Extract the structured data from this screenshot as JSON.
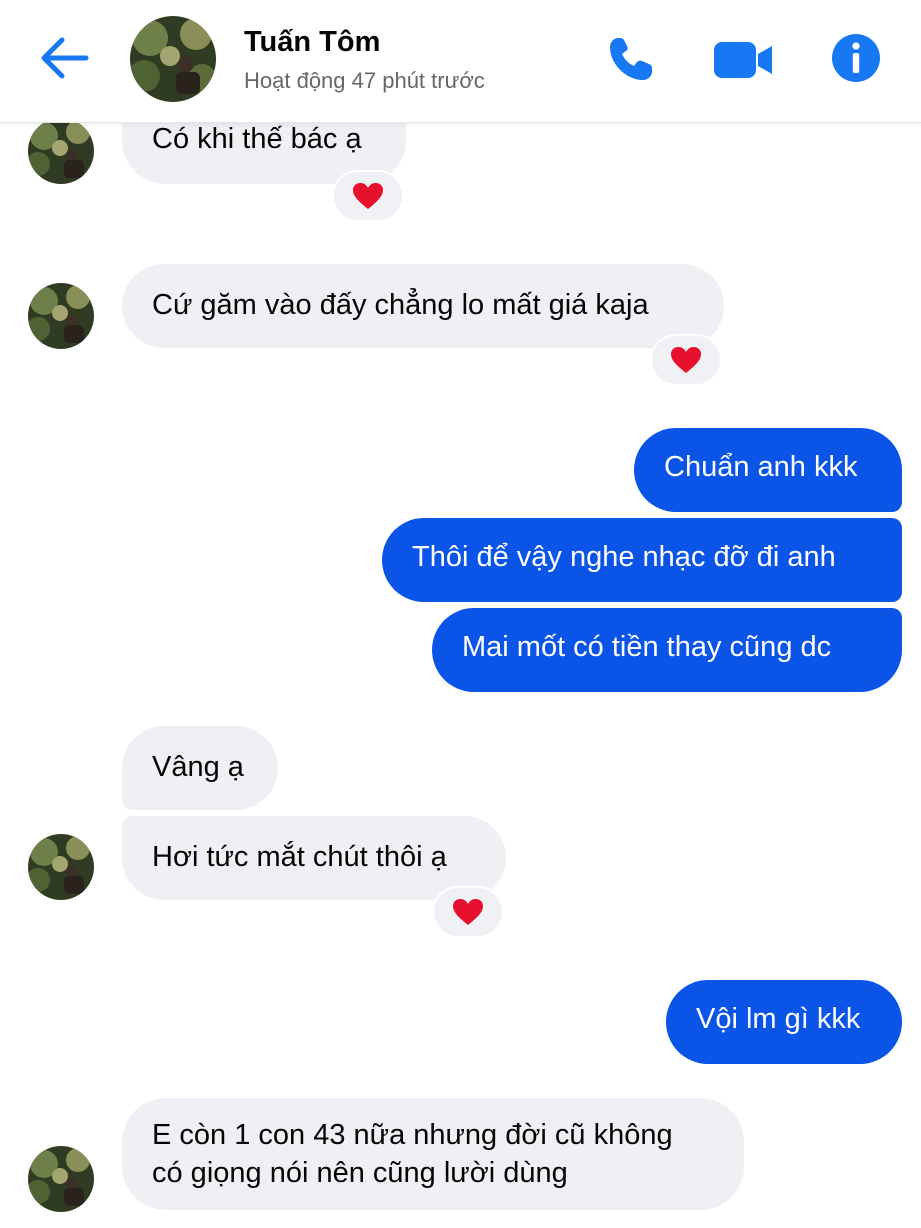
{
  "header": {
    "contact_name": "Tuấn Tôm",
    "status": "Hoạt động 47 phút trước",
    "icons": [
      "back-arrow-icon",
      "phone-icon",
      "video-camera-icon",
      "info-icon"
    ],
    "accent_color": "#1877f2"
  },
  "messages": [
    {
      "from": "contact",
      "text": "Có khi thế bác ạ",
      "reaction": "heart"
    },
    {
      "from": "contact",
      "text": "Cứ găm vào đấy chẳng lo mất giá kaja",
      "reaction": "heart"
    },
    {
      "from": "me",
      "text": "Chuẩn anh kkk"
    },
    {
      "from": "me",
      "text": "Thôi để vậy nghe nhạc đỡ đi anh"
    },
    {
      "from": "me",
      "text": "Mai mốt có tiền thay cũng dc"
    },
    {
      "from": "contact",
      "text": "Vâng ạ"
    },
    {
      "from": "contact",
      "text": "Hơi tức mắt chút thôi ạ",
      "reaction": "heart"
    },
    {
      "from": "me",
      "text": "Vội lm gì kkk"
    },
    {
      "from": "contact",
      "text_line1": "E còn 1 con 43 nữa nhưng đời cũ không",
      "text_line2": "có giọng nói nên cũng lười dùng"
    }
  ],
  "colors": {
    "outgoing_bubble": "#0a54e8",
    "incoming_bubble": "#eff0f3",
    "reaction_heart": "#e8112d"
  }
}
